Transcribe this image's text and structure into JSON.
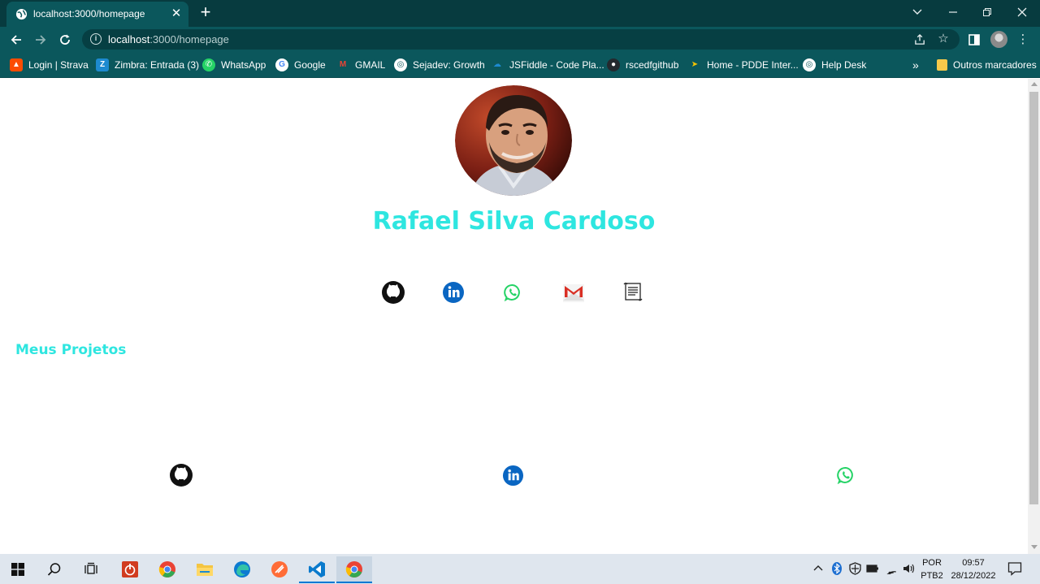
{
  "browser": {
    "tab_title": "localhost:3000/homepage",
    "tab_close": "✕",
    "new_tab": "+",
    "url_host": "localhost",
    "url_path": ":3000/homepage",
    "bookmarks": [
      {
        "label": "Login | Strava",
        "icon": "strava-icon",
        "color": "#fc4c02"
      },
      {
        "label": "Zimbra: Entrada (3)",
        "icon": "zimbra-icon",
        "color": "#1d8ad0"
      },
      {
        "label": "WhatsApp",
        "icon": "whatsapp-icon",
        "color": "#25d366"
      },
      {
        "label": "Google",
        "icon": "google-icon",
        "color": "#ffffff"
      },
      {
        "label": "GMAIL",
        "icon": "gmail-icon",
        "color": "#ea4335"
      },
      {
        "label": "Sejadev: Growth",
        "icon": "globe-icon",
        "color": "#ffffff"
      },
      {
        "label": "JSFiddle - Code Pla...",
        "icon": "cloud-icon",
        "color": "#1d8ad0"
      },
      {
        "label": "rscedfgithub",
        "icon": "github-icon",
        "color": "#24292e"
      },
      {
        "label": "Home - PDDE Inter...",
        "icon": "pdde-icon",
        "color": "#f5c400"
      },
      {
        "label": "Help Desk",
        "icon": "globe-icon",
        "color": "#ffffff"
      }
    ],
    "bookmarks_overflow": "»",
    "other_bookmarks": "Outros marcadores"
  },
  "page": {
    "name": "Rafael Silva Cardoso",
    "social_links": [
      {
        "name": "github-icon",
        "label": "GitHub"
      },
      {
        "name": "linkedin-icon",
        "label": "LinkedIn"
      },
      {
        "name": "whatsapp-icon",
        "label": "WhatsApp"
      },
      {
        "name": "gmail-icon",
        "label": "Gmail"
      },
      {
        "name": "resume-icon",
        "label": "Currículo"
      }
    ],
    "projects_title": "Meus Projetos",
    "project_links": [
      {
        "name": "github-icon"
      },
      {
        "name": "linkedin-icon"
      },
      {
        "name": "whatsapp-icon"
      }
    ],
    "colors": {
      "accent": "#2ee6e0",
      "linkedin": "#0a66c2",
      "whatsapp": "#25d366",
      "github": "#111111"
    }
  },
  "taskbar": {
    "language_top": "POR",
    "language_bottom": "PTB2",
    "time": "09:57",
    "date": "28/12/2022"
  }
}
